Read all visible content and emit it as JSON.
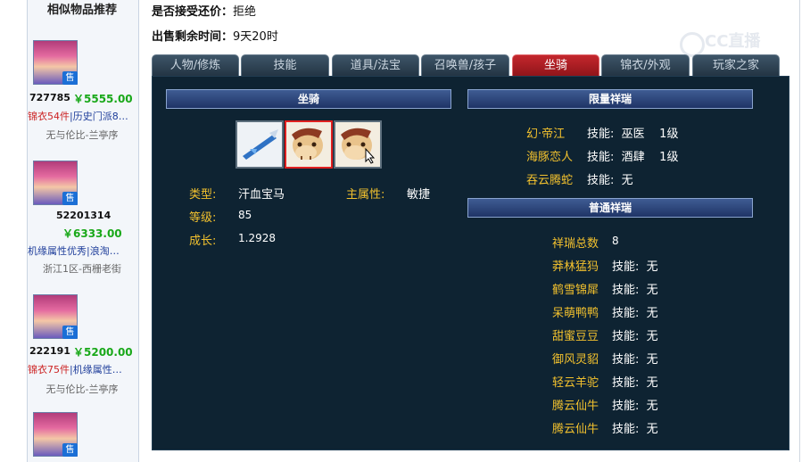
{
  "sidebar": {
    "title": "相似物品推荐",
    "items": [
      {
        "id": "727785",
        "price": "￥5555.00",
        "desc_a": "锦衣54件",
        "desc_b": "|历史门派8…",
        "server": "无与伦比-兰亭序",
        "sell": "售"
      },
      {
        "id": "52201314",
        "price": "￥6333.00",
        "desc_a": "",
        "desc_b": "机缘属性优秀|浪淘…",
        "server": "浙江1区-西栅老街",
        "sell": "售"
      },
      {
        "id": "222191",
        "price": "￥5200.00",
        "desc_a": "锦衣75件",
        "desc_b": "|机缘属性…",
        "server": "无与伦比-兰亭序",
        "sell": "售"
      },
      {
        "id": "",
        "price": "",
        "desc_a": "",
        "desc_b": "",
        "server": "",
        "sell": "售"
      }
    ]
  },
  "info": {
    "counter_offer_label": "是否接受还价：",
    "counter_offer_value": "拒绝",
    "time_left_label": "出售剩余时间：",
    "time_left_value": "9天20时"
  },
  "watermark": "CC直播",
  "tabs": [
    {
      "label": "人物/修炼",
      "active": false
    },
    {
      "label": "技能",
      "active": false
    },
    {
      "label": "道具/法宝",
      "active": false
    },
    {
      "label": "召唤兽/孩子",
      "active": false
    },
    {
      "label": "坐骑",
      "active": true
    },
    {
      "label": "锦衣/外观",
      "active": false
    },
    {
      "label": "玩家之家",
      "active": false
    }
  ],
  "mount": {
    "header": "坐骑",
    "type_label": "类型:",
    "type_value": "汗血宝马",
    "attr_label": "主属性:",
    "attr_value": "敏捷",
    "level_label": "等级:",
    "level_value": "85",
    "growth_label": "成长:",
    "growth_value": "1.2928"
  },
  "limited": {
    "header": "限量祥瑞",
    "items": [
      {
        "name": "幻·帝江",
        "skill": "技能:  巫医    1级"
      },
      {
        "name": "海豚恋人",
        "skill": "技能:  酒肆    1级"
      },
      {
        "name": "吞云腾蛇",
        "skill": "技能:  无"
      }
    ]
  },
  "normal": {
    "header": "普通祥瑞",
    "total_label": "祥瑞总数",
    "total_value": "8",
    "items": [
      {
        "name": "莽林猛犸",
        "skill": "技能:  无"
      },
      {
        "name": "鹤雪锦犀",
        "skill": "技能:  无"
      },
      {
        "name": "呆萌鸭鸭",
        "skill": "技能:  无"
      },
      {
        "name": "甜蜜豆豆",
        "skill": "技能:  无"
      },
      {
        "name": "御风灵貂",
        "skill": "技能:  无"
      },
      {
        "name": "轻云羊驼",
        "skill": "技能:  无"
      },
      {
        "name": "腾云仙牛",
        "skill": "技能:  无"
      },
      {
        "name": "腾云仙牛",
        "skill": "技能:  无"
      }
    ]
  }
}
